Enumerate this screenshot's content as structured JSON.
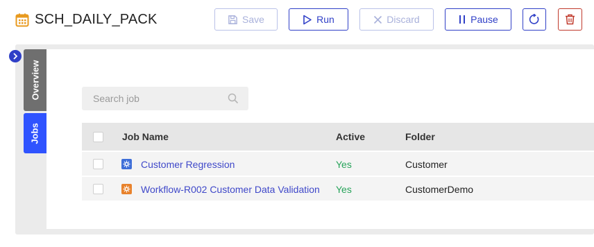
{
  "header": {
    "title": "SCH_DAILY_PACK",
    "title_icon": "calendar-icon",
    "buttons": {
      "save": "Save",
      "run": "Run",
      "discard": "Discard",
      "pause": "Pause"
    }
  },
  "tabs": {
    "overview": "Overview",
    "jobs": "Jobs"
  },
  "search": {
    "placeholder": "Search job"
  },
  "table": {
    "headers": {
      "job_name": "Job Name",
      "active": "Active",
      "folder": "Folder"
    },
    "rows": [
      {
        "job_name": "Customer Regression",
        "active": "Yes",
        "folder": "Customer",
        "icon": "gear-icon",
        "icon_color": "#3f6fd8"
      },
      {
        "job_name": "Workflow-R002 Customer Data Validation",
        "active": "Yes",
        "folder": "CustomerDemo",
        "icon": "workflow-icon",
        "icon_color": "#e8822c"
      }
    ]
  },
  "colors": {
    "accent": "#2f3fc7",
    "jobs_tab": "#2f53ff",
    "active": "#27a35a",
    "danger": "#c0392b"
  }
}
